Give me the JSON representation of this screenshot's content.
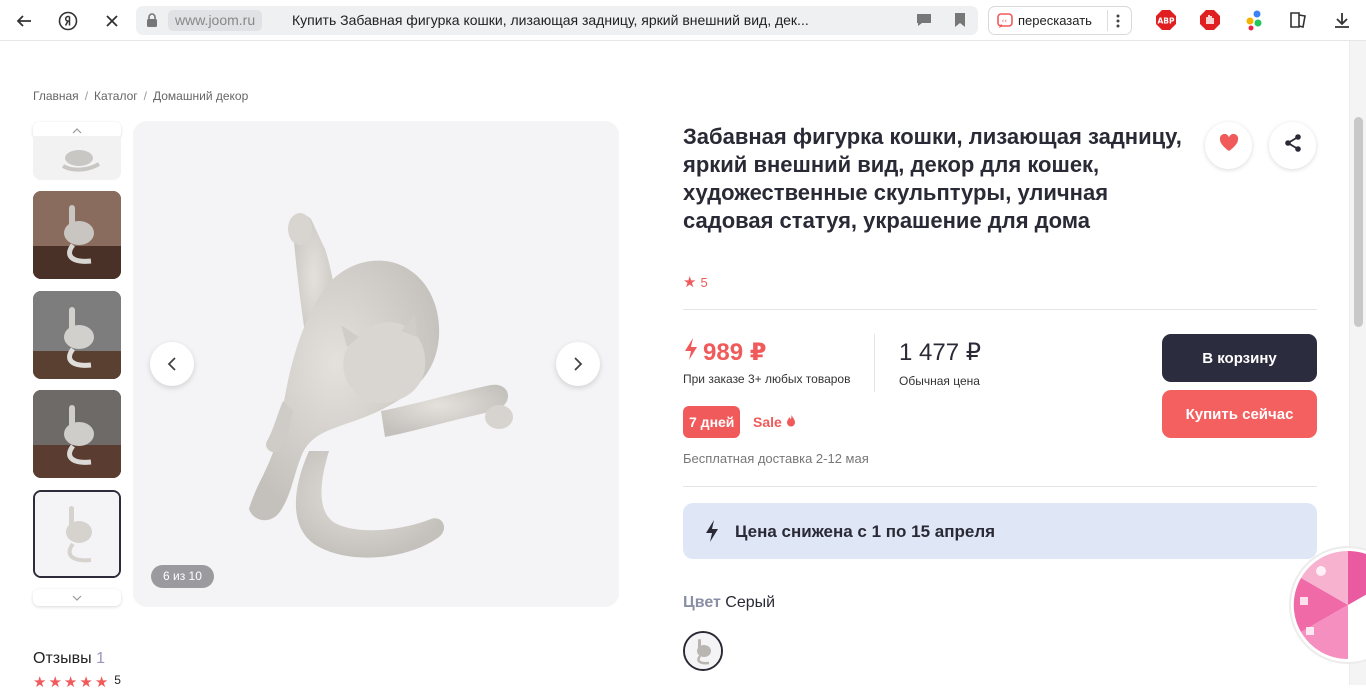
{
  "browser": {
    "domain": "www.joom.ru",
    "tab_title": "Купить Забавная фигурка кошки, лизающая задницу, яркий внешний вид, дек...",
    "retell_label": "пересказать"
  },
  "breadcrumb": [
    "Главная",
    "Каталог",
    "Домашний декор"
  ],
  "gallery": {
    "counter": "6 из 10",
    "thumb_count": 5,
    "selected_index": 4
  },
  "product": {
    "title": "Забавная фигурка кошки, лизающая задницу, яркий внешний вид, декор для кошек, художественные скульптуры, уличная садовая статуя, украшение для дома",
    "rating": "5",
    "price": "989 ₽",
    "price_note": "При заказе 3+ любых товаров",
    "regular_price": "1 477 ₽",
    "regular_note": "Обычная цена",
    "days_badge": "7 дней",
    "sale_label": "Sale",
    "delivery": "Бесплатная доставка 2-12 мая",
    "cart_button": "В корзину",
    "buy_button": "Купить сейчас",
    "promo_text": "Цена снижена с 1 по 15 апреля",
    "color_key": "Цвет",
    "color_value": "Серый"
  },
  "reviews": {
    "label": "Отзывы",
    "count": "1",
    "rating": "5"
  },
  "colors": {
    "accent": "#f05a5a",
    "dark_button": "#2b2c3d",
    "promo_bg": "#dfe6f6"
  }
}
